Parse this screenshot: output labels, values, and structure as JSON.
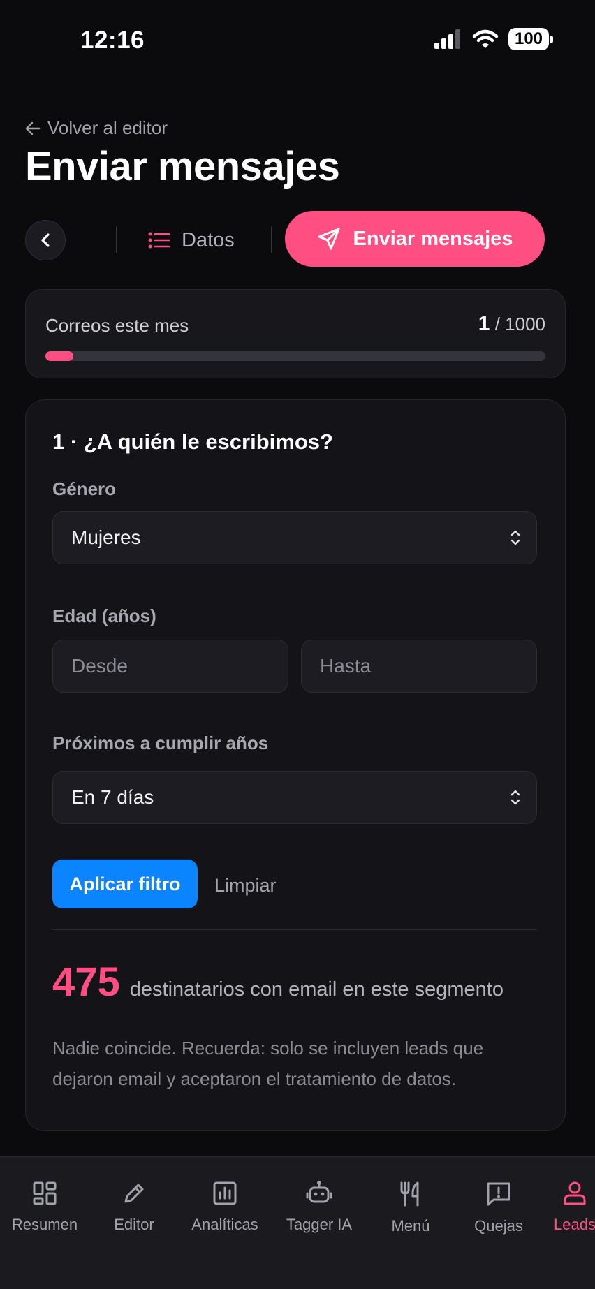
{
  "status_bar": {
    "time": "12:16",
    "battery": "100"
  },
  "header": {
    "back_label": "Volver al editor",
    "title": "Enviar mensajes"
  },
  "toolbar": {
    "data_tab_label": "Datos",
    "send_tab_label": "Enviar mensajes"
  },
  "quota": {
    "label": "Correos este mes",
    "used": "1",
    "separator": " / ",
    "limit": "1000",
    "used_fraction": 0.001
  },
  "filter": {
    "title": "1 · ¿A quién le escribimos?",
    "gender": {
      "label": "Género",
      "value": "Mujeres"
    },
    "age": {
      "label": "Edad (años)",
      "from_placeholder": "Desde",
      "to_placeholder": "Hasta"
    },
    "birthday": {
      "label": "Próximos a cumplir años",
      "value": "En 7 días"
    },
    "apply_label": "Aplicar filtro",
    "clear_label": "Limpiar"
  },
  "result": {
    "count": "475",
    "text": "destinatarios con email en este segmento",
    "note": "Nadie coincide. Recuerda: solo se incluyen leads que dejaron email y aceptaron el tratamiento de datos."
  },
  "bottom_nav": {
    "items": [
      {
        "label": "Resumen",
        "icon": "dashboard-icon"
      },
      {
        "label": "Editor",
        "icon": "pencil-icon"
      },
      {
        "label": "Analíticas",
        "icon": "bar-chart-icon"
      },
      {
        "label": "Tagger IA",
        "icon": "robot-icon"
      },
      {
        "label": "Menú",
        "icon": "utensils-icon"
      },
      {
        "label": "Quejas",
        "icon": "alert-message-icon"
      },
      {
        "label": "Leads",
        "icon": "person-icon"
      }
    ],
    "active": "Leads"
  },
  "colors": {
    "accent": "#ff4f82",
    "primary_button": "#0a84ff",
    "background": "#0b0b0e",
    "card": "#141418"
  }
}
